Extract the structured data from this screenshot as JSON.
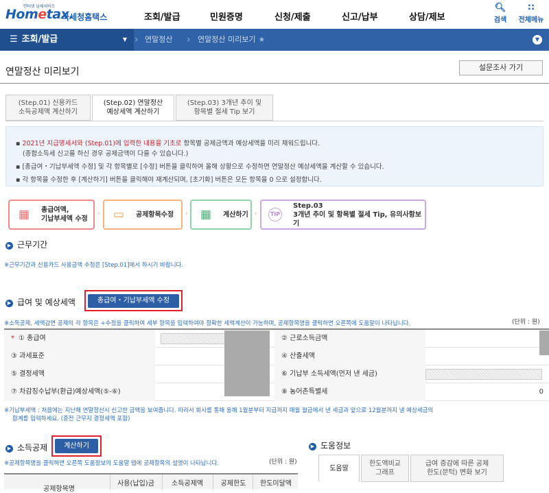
{
  "header": {
    "logo_small": "안터넷 납세서비스",
    "logo_main_a": "Hom",
    "logo_main_b": "e",
    "logo_main_c": "tax.",
    "logo_sub": "국세청홈택스",
    "nav": [
      "조회/발급",
      "민원증명",
      "신청/제출",
      "신고/납부",
      "상담/제보"
    ],
    "search_label": "검색",
    "allmenu_label": "전체메뉴"
  },
  "navbar": {
    "menu_label": "조회/발급",
    "crumb1": "연말정산",
    "crumb2": "연말정산 미리보기"
  },
  "page": {
    "title": "연말정산 미리보기",
    "survey_button": "설문조사 가기"
  },
  "step_tabs": [
    {
      "line1": "(Step.01) 신용카드",
      "line2": "소득공제액 계산하기"
    },
    {
      "line1": "(Step.02) 연말정산",
      "line2": "예상세액 계산하기"
    },
    {
      "line1": "(Step.03) 3개년 추이 및",
      "line2": "항목별 절세 Tip 보기"
    }
  ],
  "info": {
    "l1_red": "2021년 지급명세서와 (Step.01)에 입력한 내용을 기초로",
    "l1_rest": " 항목별 공제금액과 예상세액을 미리 채워드립니다.",
    "l2": "(종합소득세 신고를 하신 경우 공제금액이 다를 수 있습니다.)",
    "l3": "[총급여・기납부세액 수정] 및 각 항목별로 [수정] 버튼을 클릭하여 올해 상황으로 수정하면 연말정산 예상세액을 계산할 수 있습니다.",
    "l4": "각 항목을 수정한 후 [계산하기] 버튼을 클릭해야 재계산되며, [초기화] 버튼은 모든 항목을 0 으로 설정합니다."
  },
  "flow": [
    {
      "line1": "총급여액,",
      "line2": "기납부세액 수정",
      "color": "#f08a8a",
      "icon": "calendar-icon"
    },
    {
      "line1": "공제항목수정",
      "line2": "",
      "color": "#f5b27a",
      "icon": "monitor-icon"
    },
    {
      "line1": "계산하기",
      "line2": "",
      "color": "#8fd3a8",
      "icon": "calculator-icon"
    },
    {
      "line1": "Step.03",
      "line2": "3개년 추이 및 항목별 절세 Tip, 유의사항보기",
      "color": "#c9a6e6",
      "icon": "tip-icon"
    }
  ],
  "work_period": {
    "title": "근무기간",
    "note": "※근무기간과 신용카드 사용금액 수정은 [Step.01]에서 하시기 바랍니다."
  },
  "salary": {
    "title": "급여 및 예상세액",
    "edit_button": "총급여・기납부세액 수정",
    "note": "※소득공제, 세액감면 공제의 각 항목은 +수정을 클릭하여 세부 항목을 입력하여야 정확한 세액계산이 가능하며, 공제항목명을 클릭하면 오른쪽에 도움말이 나타납니다.",
    "unit": "(단위 : 원)",
    "rows": [
      {
        "left": "① 총급여",
        "right": "② 근로소득금액",
        "right_val": ""
      },
      {
        "left": "③ 과세표준",
        "right": "④ 산출세액",
        "right_val": ""
      },
      {
        "left": "⑤ 결정세액",
        "right": "⑥ 기납부 소득세액(먼저 낸 세금)",
        "right_val": ""
      },
      {
        "left": "⑦ 차감징수납부(환급)예상세액(⑤-⑥)",
        "right": "⑧ 농어촌특별세",
        "right_val": "0"
      }
    ],
    "required_mark": "*",
    "footnote1": "※기납부세액 : 처음에는 지난해 연말정산시 신고한 금액을 보여줍니다. 따라서 회사를 통해 올해 1월분부터 지급까지 매월 월급에서 낸 세금과 앞으로 12월분까지 낼 예상세금의",
    "footnote2": "합계를 입력하세요. (중전 근무지 결정세액 포함)"
  },
  "deduction": {
    "title": "소득공제",
    "calc_button": "계산하기",
    "note": "※공제항목명을 클릭하면 오른쪽 도움정보의 도움말 탭에 공제항목의 설명이 나타납니다.",
    "unit": "(단위 : 원)",
    "headers": [
      "공제항목명",
      "사용(납입)금",
      "소득공제액",
      "공제한도",
      "한도미달액"
    ]
  },
  "help": {
    "title": "도움정보",
    "tabs": [
      {
        "line1": "도움말",
        "line2": ""
      },
      {
        "line1": "한도액비교",
        "line2": "그래프"
      },
      {
        "line1": "급여 증감에 따른 공제",
        "line2": "한도(문턱) 변화 보기"
      }
    ]
  }
}
